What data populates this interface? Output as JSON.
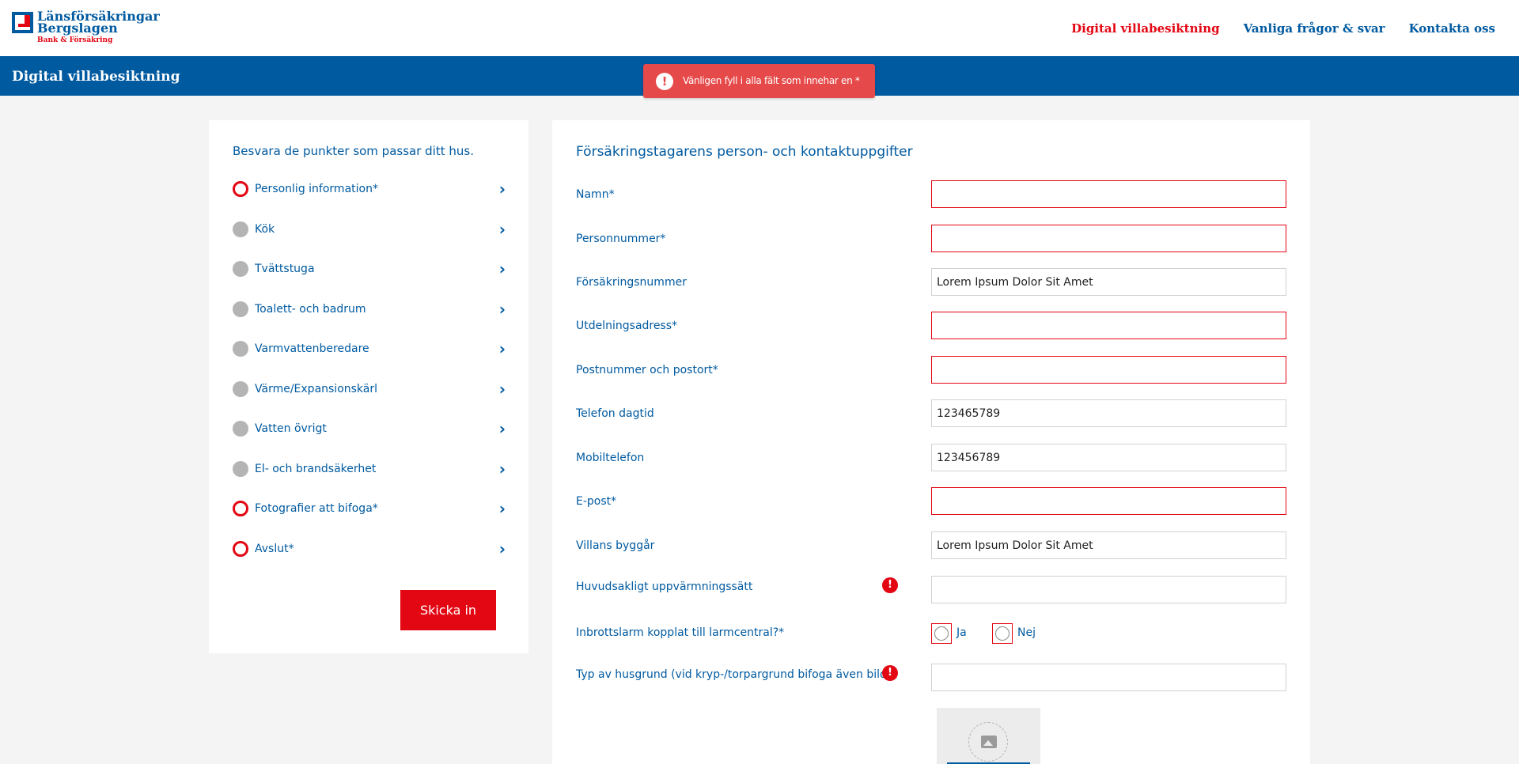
{
  "header": {
    "logo_name_line1": "Länsförsäkringar",
    "logo_name_line2": "Bergslagen",
    "logo_sub": "Bank & Försäkring",
    "nav": [
      "Digital villabesiktning",
      "Vanliga frågor & svar",
      "Kontakta oss"
    ],
    "nav_active_index": 0
  },
  "banner": {
    "title": "Digital villabesiktning"
  },
  "toast": {
    "icon": "exclamation-icon",
    "text": "Vänligen fyll i alla fält som innehar en *"
  },
  "sidebar": {
    "title": "Besvara de punkter som passar ditt hus.",
    "items": [
      {
        "label": "Personlig information*",
        "status": "required"
      },
      {
        "label": "Kök",
        "status": "neutral"
      },
      {
        "label": "Tvättstuga",
        "status": "neutral"
      },
      {
        "label": "Toalett- och badrum",
        "status": "neutral"
      },
      {
        "label": "Varmvattenberedare",
        "status": "neutral"
      },
      {
        "label": "Värme/Expansionskärl",
        "status": "neutral"
      },
      {
        "label": "Vatten övrigt",
        "status": "neutral"
      },
      {
        "label": "El- och brandsäkerhet",
        "status": "neutral"
      },
      {
        "label": "Fotografier att bifoga*",
        "status": "required"
      },
      {
        "label": "Avslut*",
        "status": "required"
      }
    ],
    "submit_label": "Skicka in"
  },
  "form": {
    "title": "Försäkringstagarens person- och kontaktuppgifter",
    "fields": {
      "namn": {
        "label": "Namn*",
        "value": ""
      },
      "personnummer": {
        "label": "Personnummer*",
        "value": ""
      },
      "forsakringsnummer": {
        "label": "Försäkringsnummer",
        "value": "Lorem Ipsum Dolor Sit Amet"
      },
      "utdelningsadress": {
        "label": "Utdelningsadress*",
        "value": ""
      },
      "postnummer": {
        "label": "Postnummer och postort*",
        "value": ""
      },
      "telefon": {
        "label": "Telefon dagtid",
        "value": "123465789"
      },
      "mobil": {
        "label": "Mobiltelefon",
        "value": "123456789"
      },
      "epost": {
        "label": "E-post*",
        "value": ""
      },
      "byggar": {
        "label": "Villans byggår",
        "value": "Lorem Ipsum Dolor Sit Amet"
      },
      "uppvarmning": {
        "label": "Huvudsakligt uppvärmningssätt",
        "value": ""
      },
      "husgrund": {
        "label": "Typ av husgrund (vid kryp-/torpargrund bifoga även bild)",
        "value": ""
      }
    },
    "larm": {
      "label": "Inbrottslarm kopplat till larmcentral?*",
      "options": [
        "Ja",
        "Nej"
      ]
    },
    "upload_icon": "image-icon",
    "colors": {
      "brand_blue": "#005aa0",
      "brand_red": "#e30613",
      "toast_red": "#e64949"
    }
  }
}
